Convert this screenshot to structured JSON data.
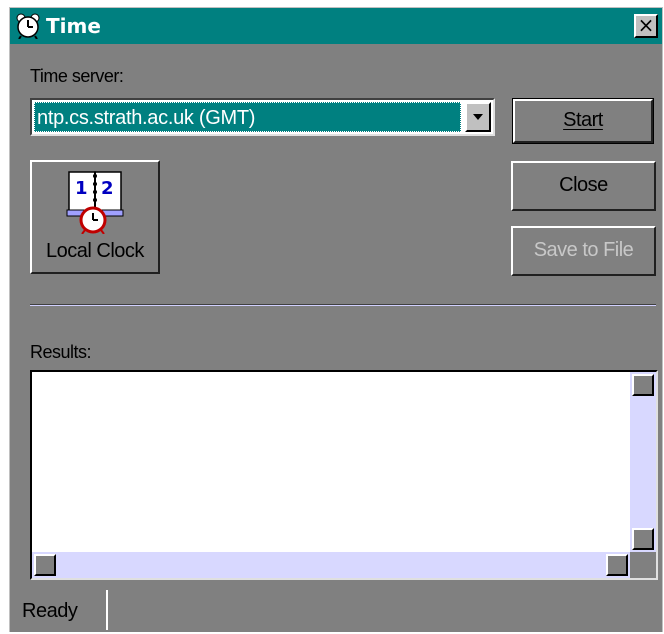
{
  "window": {
    "title": "Time",
    "icon": "alarm-clock-icon",
    "close_glyph": "×"
  },
  "time_server": {
    "label": "Time server:",
    "selected": "ntp.cs.strath.ac.uk (GMT)"
  },
  "buttons": {
    "start": "Start",
    "close": "Close",
    "save_to_file": "Save to File",
    "local_clock": "Local Clock"
  },
  "results": {
    "label": "Results:",
    "text": ""
  },
  "status": {
    "text": "Ready"
  },
  "colors": {
    "title_bar": "#008080",
    "window_bg": "#808080",
    "selection": "#008080",
    "scroll_track": "#d8d8ff"
  }
}
